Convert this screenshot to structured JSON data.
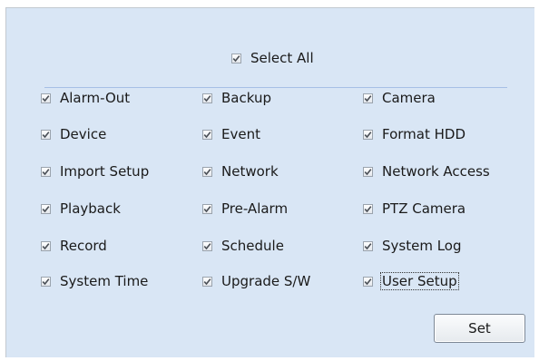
{
  "select_all": {
    "label": "Select All",
    "checked": true
  },
  "permissions": {
    "rows": [
      [
        {
          "label": "Alarm-Out",
          "checked": true
        },
        {
          "label": "Backup",
          "checked": true
        },
        {
          "label": "Camera",
          "checked": true
        }
      ],
      [
        {
          "label": "Device",
          "checked": true
        },
        {
          "label": "Event",
          "checked": true
        },
        {
          "label": "Format HDD",
          "checked": true
        }
      ],
      [
        {
          "label": "Import Setup",
          "checked": true
        },
        {
          "label": "Network",
          "checked": true
        },
        {
          "label": "Network Access",
          "checked": true
        }
      ],
      [
        {
          "label": "Playback",
          "checked": true
        },
        {
          "label": "Pre-Alarm",
          "checked": true
        },
        {
          "label": "PTZ Camera",
          "checked": true
        }
      ],
      [
        {
          "label": "Record",
          "checked": true
        },
        {
          "label": "Schedule",
          "checked": true
        },
        {
          "label": "System Log",
          "checked": true
        }
      ],
      [
        {
          "label": "System Time",
          "checked": true
        },
        {
          "label": "Upgrade S/W",
          "checked": true
        },
        {
          "label": "User Setup",
          "checked": true,
          "focused": true
        }
      ]
    ]
  },
  "actions": {
    "set_label": "Set"
  },
  "colors": {
    "panel_bg": "#d9e6f5",
    "divider": "#a6c0e6",
    "checkmark": "#4a4f56"
  },
  "icons": {
    "checkbox_check": "checkmark-icon"
  }
}
